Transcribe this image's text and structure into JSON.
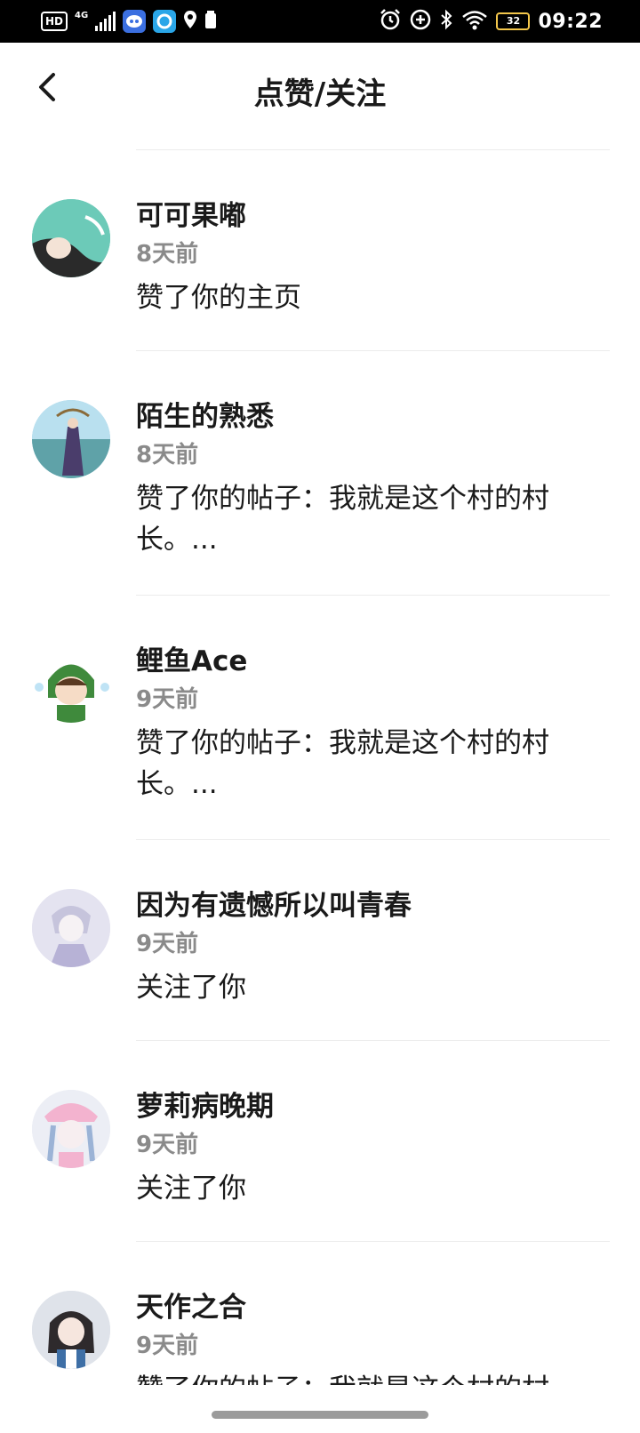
{
  "status_bar": {
    "hd_badge": "HD",
    "network": "4G",
    "battery_level": "32",
    "time": "09:22"
  },
  "header": {
    "title": "点赞/关注"
  },
  "notifications": [
    {
      "username": "可可果嘟",
      "time": "8天前",
      "action": "赞了你的主页"
    },
    {
      "username": "陌生的熟悉",
      "time": "8天前",
      "action": "赞了你的帖子：我就是这个村的村长。..."
    },
    {
      "username": "鲤鱼Ace",
      "time": "9天前",
      "action": "赞了你的帖子：我就是这个村的村长。..."
    },
    {
      "username": "因为有遗憾所以叫青春",
      "time": "9天前",
      "action": "关注了你"
    },
    {
      "username": "萝莉病晚期",
      "time": "9天前",
      "action": "关注了你"
    },
    {
      "username": "天作之合",
      "time": "9天前",
      "action": "赞了你的帖子：我就是这个村的村长。..."
    }
  ]
}
